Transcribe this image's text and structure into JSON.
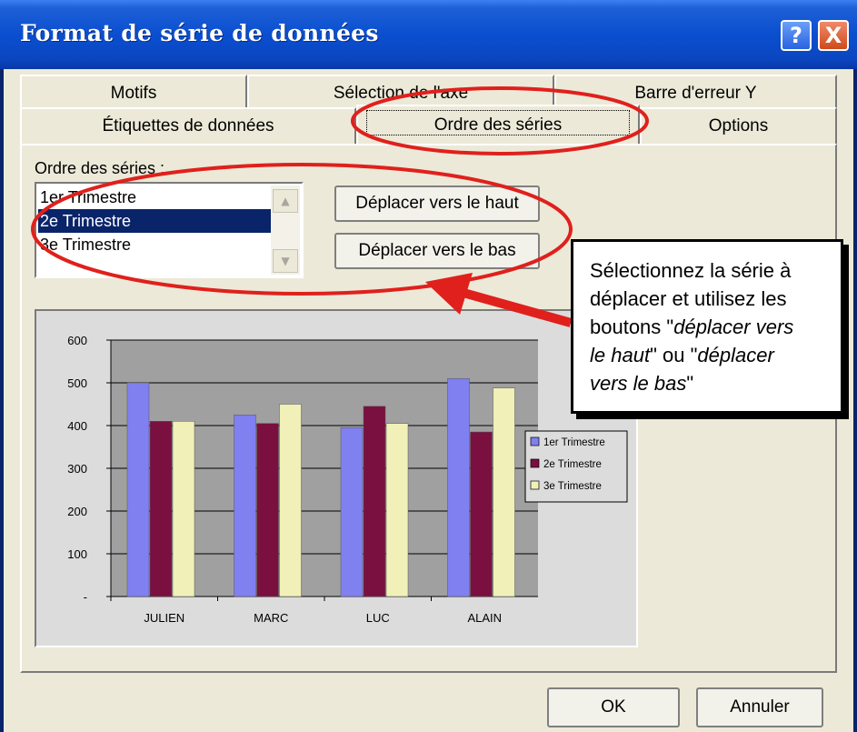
{
  "window": {
    "title": "Format de série de données"
  },
  "titlebar_buttons": {
    "help": "?",
    "close": "X"
  },
  "tabs_row1": [
    "Motifs",
    "Sélection de l'axe",
    "Barre d'erreur Y"
  ],
  "tabs_row2": [
    "Étiquettes de données",
    "Ordre des séries",
    "Options"
  ],
  "active_tab": "Ordre des séries",
  "series_order": {
    "label": "Ordre des séries :",
    "items": [
      "1er Trimestre",
      "2e Trimestre",
      "3e Trimestre"
    ],
    "selected": "2e Trimestre",
    "move_up": "Déplacer vers le haut",
    "move_down": "Déplacer vers le bas"
  },
  "annotation": {
    "line1": "Sélectionnez la série à",
    "line2": "déplacer et utilisez les",
    "line3_pre": "boutons \"",
    "line3_em": "déplacer vers",
    "line4_em": "le haut",
    "line4_post": "\" ou \"",
    "line4_em2": "déplacer",
    "line5_em": "vers le bas",
    "line5_post": "\""
  },
  "footer": {
    "ok": "OK",
    "cancel": "Annuler"
  },
  "icons": {
    "scroll_up": "scroll-up-arrow-icon",
    "scroll_down": "scroll-down-arrow-icon"
  },
  "colors": {
    "ellipse": "#e0201c",
    "series1": "#8080f0",
    "series2": "#7a1040",
    "series3": "#f0f0b8",
    "plot_bg": "#a0a0a0",
    "title_bar": "#0a4fd0"
  },
  "chart_data": {
    "type": "bar",
    "categories": [
      "JULIEN",
      "MARC",
      "LUC",
      "ALAIN"
    ],
    "series": [
      {
        "name": "1er Trimestre",
        "values": [
          500,
          425,
          395,
          510
        ]
      },
      {
        "name": "2e Trimestre",
        "values": [
          410,
          405,
          445,
          385
        ]
      },
      {
        "name": "3e Trimestre",
        "values": [
          410,
          450,
          405,
          488
        ]
      }
    ],
    "ylim": [
      0,
      600
    ],
    "yticks": [
      "-",
      "100",
      "200",
      "300",
      "400",
      "500",
      "600"
    ],
    "grid": true,
    "legend": "right",
    "title": "",
    "xlabel": "",
    "ylabel": ""
  }
}
